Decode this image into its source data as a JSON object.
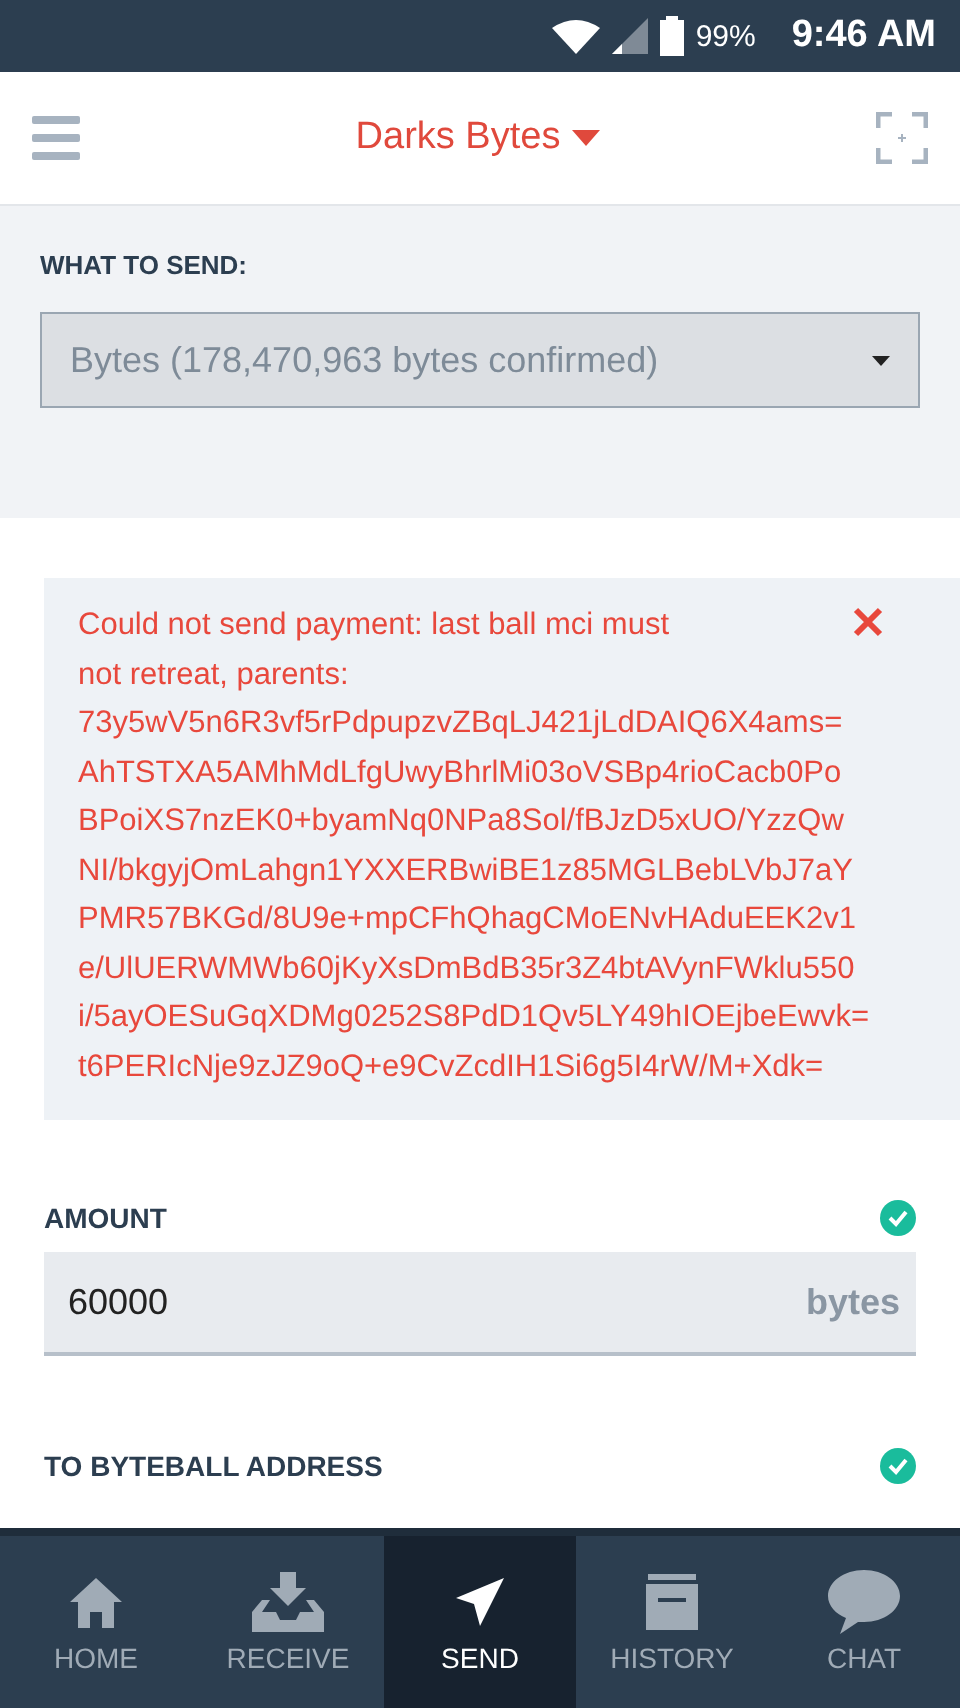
{
  "status_bar": {
    "battery": "99%",
    "time": "9:46 AM"
  },
  "header": {
    "title": "Darks Bytes"
  },
  "asset": {
    "label": "WHAT TO SEND:",
    "value": "Bytes (178,470,963 bytes confirmed)"
  },
  "error": {
    "lines": [
      "Could not send payment: last ball mci must",
      "not retreat, parents:",
      "73y5wV5n6R3vf5rPdpupzvZBqLJ421jLdDAIQ6X4ams=",
      "AhTSTXA5AMhMdLfgUwyBhrlMi03oVSBp4rioCacb0Po",
      "BPoiXS7nzEK0+byamNq0NPa8Sol/fBJzD5xUO/YzzQw",
      "NI/bkgyjOmLahgn1YXXERBwiBE1z85MGLBebLVbJ7aY",
      "PMR57BKGd/8U9e+mpCFhQhagCMoENvHAduEEK2v1",
      "e/UlUERWMWb60jKyXsDmBdB35r3Z4btAVynFWklu550",
      "i/5ayOESuGqXDMg0252S8PdD1Qv5LY49hIOEjbeEwvk=",
      "t6PERIcNje9zJZ9oQ+e9CvZcdIH1Si6g5I4rW/M+Xdk="
    ]
  },
  "amount": {
    "label": "AMOUNT",
    "valid": true,
    "value": "60000",
    "unit": "bytes"
  },
  "address": {
    "label": "TO BYTEBALL ADDRESS",
    "valid": true
  },
  "nav": [
    {
      "label": "HOME",
      "kind": "home",
      "selected": false
    },
    {
      "label": "RECEIVE",
      "kind": "receive",
      "selected": false
    },
    {
      "label": "SEND",
      "kind": "send",
      "selected": true
    },
    {
      "label": "HISTORY",
      "kind": "history",
      "selected": false
    },
    {
      "label": "CHAT",
      "kind": "chat",
      "selected": false
    }
  ]
}
